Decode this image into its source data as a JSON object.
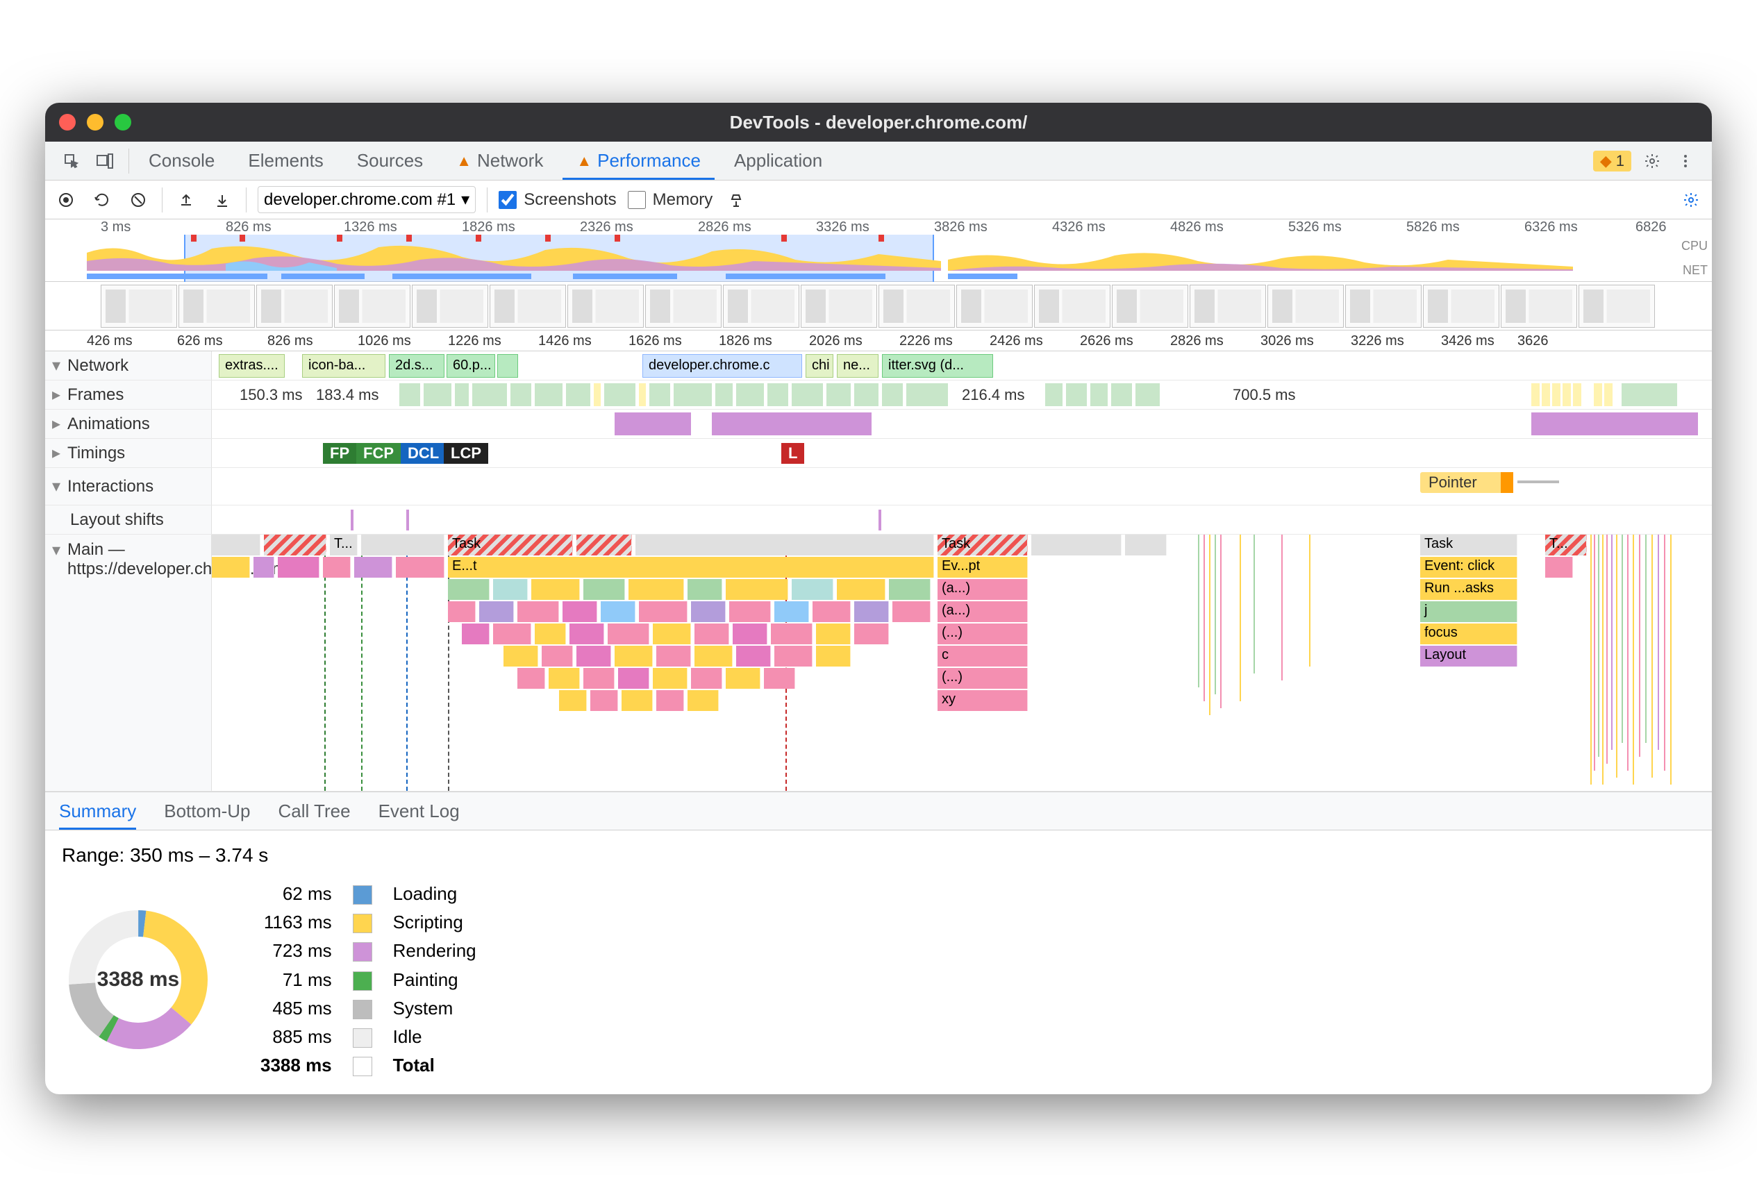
{
  "window_title": "DevTools - developer.chrome.com/",
  "tabs": {
    "console": "Console",
    "elements": "Elements",
    "sources": "Sources",
    "network": "Network",
    "performance": "Performance",
    "application": "Application"
  },
  "issues_count": "1",
  "toolbar": {
    "profile": "developer.chrome.com #1",
    "screenshots": "Screenshots",
    "memory": "Memory"
  },
  "overview": {
    "ticks": [
      "3 ms",
      "826 ms",
      "1326 ms",
      "1826 ms",
      "2326 ms",
      "2826 ms",
      "3326 ms",
      "3826 ms",
      "4326 ms",
      "4826 ms",
      "5326 ms",
      "5826 ms",
      "6326 ms",
      "6826"
    ],
    "cpu_label": "CPU",
    "net_label": "NET"
  },
  "tracks_ruler": [
    "426 ms",
    "626 ms",
    "826 ms",
    "1026 ms",
    "1226 ms",
    "1426 ms",
    "1626 ms",
    "1826 ms",
    "2026 ms",
    "2226 ms",
    "2426 ms",
    "2626 ms",
    "2826 ms",
    "3026 ms",
    "3226 ms",
    "3426 ms",
    "3626"
  ],
  "tracks": {
    "network": "Network",
    "frames": "Frames",
    "animations": "Animations",
    "timings": "Timings",
    "interactions": "Interactions",
    "layout_shifts": "Layout shifts",
    "main": "Main — https://developer.chrome.com/"
  },
  "network_items": [
    "extras....",
    "icon-ba...",
    "2d.s...",
    "60.p...",
    "",
    "developer.chrome.c",
    "chi",
    "ne...",
    "itter.svg (d..."
  ],
  "frames": {
    "f1": "150.3 ms",
    "f2": "183.4 ms",
    "f3": "216.4 ms",
    "f4": "700.5 ms"
  },
  "timings": {
    "fp": "FP",
    "fcp": "FCP",
    "dcl": "DCL",
    "lcp": "LCP",
    "l": "L"
  },
  "interactions": {
    "pointer": "Pointer"
  },
  "main": {
    "t": "T...",
    "task": "Task",
    "evt": "E...t",
    "evpt": "Ev...pt",
    "a": "(a...)",
    "paren": "(...)",
    "c": "c",
    "xy": "xy",
    "event_click": "Event: click",
    "run_tasks": "Run ...asks",
    "j": "j",
    "focus": "focus",
    "layout": "Layout"
  },
  "bottom_tabs": {
    "summary": "Summary",
    "bottomup": "Bottom-Up",
    "calltree": "Call Tree",
    "eventlog": "Event Log"
  },
  "summary": {
    "range": "Range: 350 ms – 3.74 s",
    "total_ms": "3388 ms",
    "rows": [
      {
        "ms": "62 ms",
        "label": "Loading",
        "color": "#5b9bd5"
      },
      {
        "ms": "1163 ms",
        "label": "Scripting",
        "color": "#ffd54f"
      },
      {
        "ms": "723 ms",
        "label": "Rendering",
        "color": "#ce93d8"
      },
      {
        "ms": "71 ms",
        "label": "Painting",
        "color": "#4caf50"
      },
      {
        "ms": "485 ms",
        "label": "System",
        "color": "#bdbdbd"
      },
      {
        "ms": "885 ms",
        "label": "Idle",
        "color": "#eeeeee"
      }
    ],
    "total_row": {
      "ms": "3388 ms",
      "label": "Total"
    }
  },
  "chart_data": {
    "type": "pie",
    "title": "3388 ms",
    "series": [
      {
        "name": "Loading",
        "value": 62,
        "color": "#5b9bd5"
      },
      {
        "name": "Scripting",
        "value": 1163,
        "color": "#ffd54f"
      },
      {
        "name": "Rendering",
        "value": 723,
        "color": "#ce93d8"
      },
      {
        "name": "Painting",
        "value": 71,
        "color": "#4caf50"
      },
      {
        "name": "System",
        "value": 485,
        "color": "#bdbdbd"
      },
      {
        "name": "Idle",
        "value": 885,
        "color": "#eeeeee"
      }
    ],
    "total": 3388
  }
}
